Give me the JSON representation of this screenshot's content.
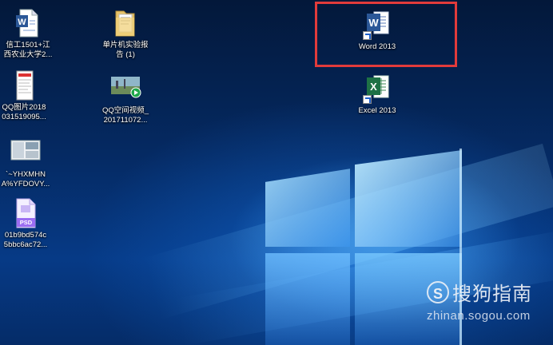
{
  "desktop": {
    "icons": [
      {
        "label": "信工1501+江\n西农业大学2...",
        "type": "word-doc"
      },
      {
        "label": "单片机实验报\n告 (1)",
        "type": "folder"
      },
      {
        "label": "Word 2013",
        "type": "word-app"
      },
      {
        "label": "QQ图片2018\n031519095...",
        "type": "image-screenshot"
      },
      {
        "label": "QQ空间视频_\n201711072...",
        "type": "video"
      },
      {
        "label": "Excel 2013",
        "type": "excel-app"
      },
      {
        "label": "`~YHXMHN\nA%YFDOVY...",
        "type": "image-thumbnail"
      },
      {
        "label": "01b9bd574c\n5bbc6ac72...",
        "type": "psd-file"
      }
    ],
    "psd_badge": "PSD",
    "highlight_color": "#e23b3b"
  },
  "watermark": {
    "logo_letter": "S",
    "text": "搜狗指南",
    "url": "zhinan.sogou.com"
  }
}
